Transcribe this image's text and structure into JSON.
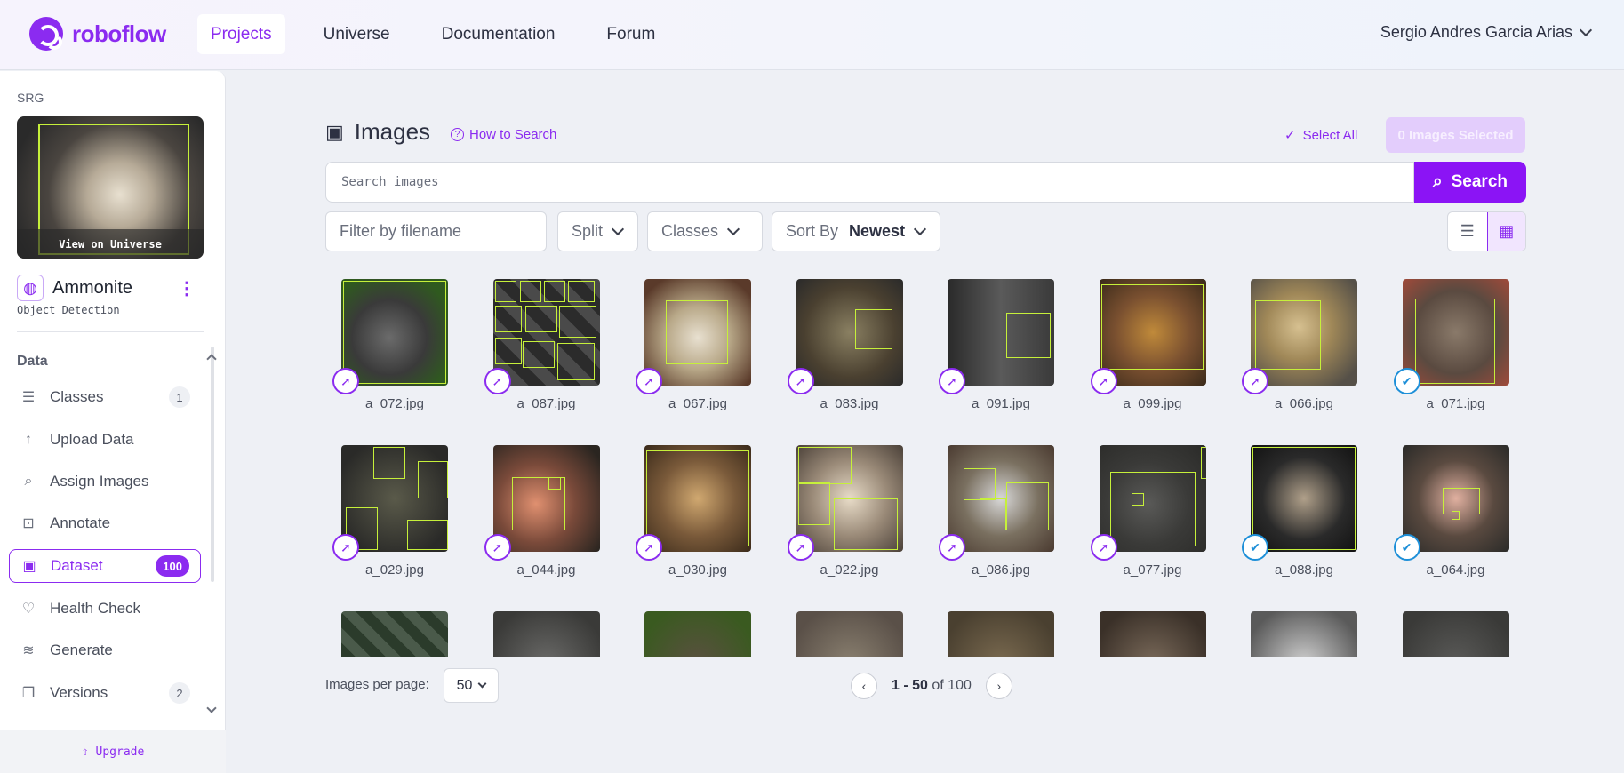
{
  "brand": {
    "name": "roboflow",
    "color": "#8b2bf0"
  },
  "nav": {
    "links": [
      "Projects",
      "Universe",
      "Documentation",
      "Forum"
    ],
    "active": "Projects",
    "user_name": "Sergio Andres Garcia Arias"
  },
  "sidebar": {
    "workspace": "SRG",
    "thumbnail_caption": "View on Universe",
    "project_name": "Ammonite",
    "project_type": "Object Detection",
    "section_title": "Data",
    "items": [
      {
        "label": "Classes",
        "icon": "list-icon",
        "badge": "1"
      },
      {
        "label": "Upload Data",
        "icon": "upload-arrow-icon",
        "badge": ""
      },
      {
        "label": "Assign Images",
        "icon": "search-icon",
        "badge": ""
      },
      {
        "label": "Annotate",
        "icon": "annotate-icon",
        "badge": ""
      },
      {
        "label": "Dataset",
        "icon": "images-icon",
        "badge": "100",
        "active": true
      },
      {
        "label": "Health Check",
        "icon": "heart-pulse-icon",
        "badge": ""
      },
      {
        "label": "Generate",
        "icon": "stack-icon",
        "badge": ""
      },
      {
        "label": "Versions",
        "icon": "versions-icon",
        "badge": "2"
      }
    ],
    "upgrade_label": "Upgrade"
  },
  "main": {
    "title": "Images",
    "how_to_search": "How to Search",
    "select_all": "Select All",
    "selected_count": "0 Images Selected",
    "search_placeholder": "Search images",
    "search_button": "Search",
    "filter_placeholder": "Filter by filename",
    "split_label": "Split",
    "classes_label": "Classes",
    "sort_label": "Sort By",
    "sort_value": "Newest"
  },
  "images": [
    {
      "name": "a_072.jpg",
      "status": "annotating"
    },
    {
      "name": "a_087.jpg",
      "status": "annotating"
    },
    {
      "name": "a_067.jpg",
      "status": "annotating"
    },
    {
      "name": "a_083.jpg",
      "status": "annotating"
    },
    {
      "name": "a_091.jpg",
      "status": "annotating"
    },
    {
      "name": "a_099.jpg",
      "status": "annotating"
    },
    {
      "name": "a_066.jpg",
      "status": "annotating"
    },
    {
      "name": "a_071.jpg",
      "status": "approved"
    },
    {
      "name": "a_029.jpg",
      "status": "annotating"
    },
    {
      "name": "a_044.jpg",
      "status": "annotating"
    },
    {
      "name": "a_030.jpg",
      "status": "annotating"
    },
    {
      "name": "a_022.jpg",
      "status": "annotating"
    },
    {
      "name": "a_086.jpg",
      "status": "annotating"
    },
    {
      "name": "a_077.jpg",
      "status": "annotating"
    },
    {
      "name": "a_088.jpg",
      "status": "approved"
    },
    {
      "name": "a_064.jpg",
      "status": "approved"
    }
  ],
  "pagination": {
    "per_page_label": "Images per page:",
    "per_page": "50",
    "range": "1 - 50",
    "of_label": "of 100"
  }
}
